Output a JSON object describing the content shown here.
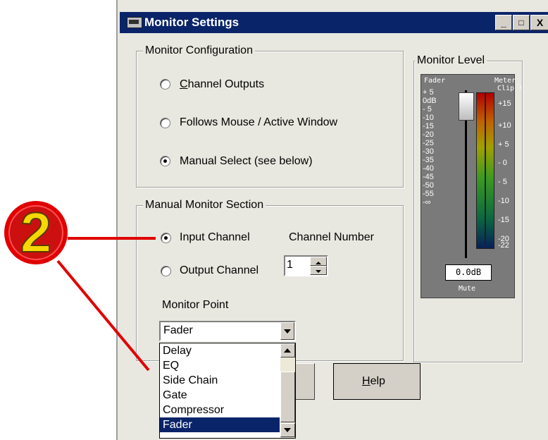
{
  "window": {
    "title": "Monitor Settings",
    "controls": {
      "minimize": "_",
      "maximize": "□",
      "close": "X"
    }
  },
  "monitor_configuration": {
    "legend": "Monitor Configuration",
    "options": [
      {
        "label": "Channel Outputs",
        "selected": false
      },
      {
        "label": "Follows Mouse / Active Window",
        "selected": false
      },
      {
        "label": "Manual Select (see below)",
        "selected": true
      }
    ]
  },
  "manual_monitor_section": {
    "legend": "Manual Monitor Section",
    "input_channel": "Input Channel",
    "output_channel": "Output Channel",
    "selected_mode": "Input Channel",
    "channel_number_label": "Channel Number",
    "channel_number_value": "1",
    "monitor_point_label": "Monitor Point",
    "monitor_point_value": "Fader",
    "monitor_point_options": [
      "Delay",
      "EQ",
      "Side Chain",
      "Gate",
      "Compressor",
      "Fader"
    ]
  },
  "monitor_level": {
    "legend": "Monitor Level",
    "fader_label": "Fader",
    "meter_label": "Meter",
    "clip_label": "Clip !",
    "fader_scale": [
      "+ 5",
      "0dB",
      "- 5",
      "-10",
      "-15",
      "-20",
      "-25",
      "-30",
      "-35",
      "-40",
      "-45",
      "-50",
      "-55",
      "-∞"
    ],
    "meter_scale": [
      "+15",
      "+10",
      "+ 5",
      "- 0",
      "- 5",
      "-10",
      "-15",
      "-20",
      "-22"
    ],
    "readout": "0.0dB",
    "mute_label": "Mute"
  },
  "buttons": {
    "help": "Help"
  },
  "annotation": {
    "step_number": "2",
    "color": "#e00000",
    "badge_color": "#f5d800"
  }
}
